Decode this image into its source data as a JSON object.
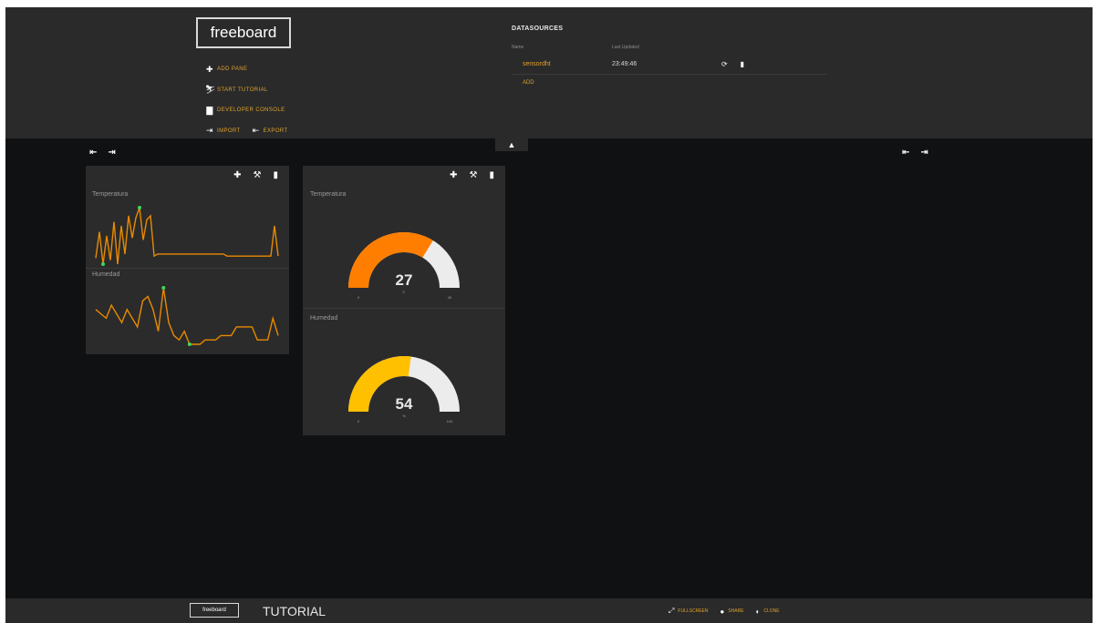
{
  "header": {
    "logo": "freeboard",
    "menu": {
      "add_pane": "ADD PANE",
      "start_tutorial": "START TUTORIAL",
      "developer_console": "DEVELOPER CONSOLE",
      "import": "IMPORT",
      "export": "EXPORT"
    },
    "datasources": {
      "title": "DATASOURCES",
      "col_name": "Name",
      "col_last_updated": "Last Updated",
      "rows": [
        {
          "name": "sensordht",
          "last_updated": "23:49:46"
        }
      ],
      "add_label": "ADD"
    }
  },
  "panes": [
    {
      "widgets": [
        {
          "title": "Temperatura",
          "type": "sparkline",
          "values": [
            3,
            16,
            0,
            14,
            2,
            21,
            0,
            19,
            5,
            24,
            13,
            23,
            28,
            12,
            22,
            24,
            4,
            5,
            5,
            5,
            5,
            5,
            5,
            5,
            5,
            5,
            5,
            5,
            5,
            5,
            5,
            5,
            5,
            5,
            5,
            5,
            4,
            4,
            4,
            4,
            4,
            4,
            4,
            4,
            4,
            4,
            4,
            4,
            4,
            19,
            4
          ]
        },
        {
          "title": "Humedad",
          "type": "sparkline",
          "values": [
            9,
            8,
            7,
            10,
            8,
            6,
            9,
            7,
            5,
            11,
            12,
            9,
            4,
            14,
            6,
            3,
            2,
            4,
            1,
            1,
            1,
            2,
            2,
            2,
            3,
            3,
            3,
            5,
            5,
            5,
            5,
            2,
            2,
            2,
            7,
            3
          ]
        }
      ]
    },
    {
      "widgets": [
        {
          "title": "Temperatura",
          "type": "gauge",
          "value": "27",
          "units": "C",
          "min": "0",
          "max": "40",
          "fill_color": "#ff7e00"
        },
        {
          "title": "Humedad",
          "type": "gauge",
          "value": "54",
          "units": "%",
          "min": "0",
          "max": "100",
          "fill_color": "#ffc000"
        }
      ]
    }
  ],
  "footer": {
    "logo": "freeboard",
    "tutorial": "TUTORIAL",
    "fullscreen": "FULLSCREEN",
    "share": "SHARE",
    "clone": "CLONE"
  },
  "colors": {
    "accent": "#e0a32a",
    "sparkline": "#e88a00",
    "sparkline_marker": "#3ed65c",
    "gauge_track": "#ececec",
    "background": "#101112",
    "panel": "#2b2b2b"
  }
}
